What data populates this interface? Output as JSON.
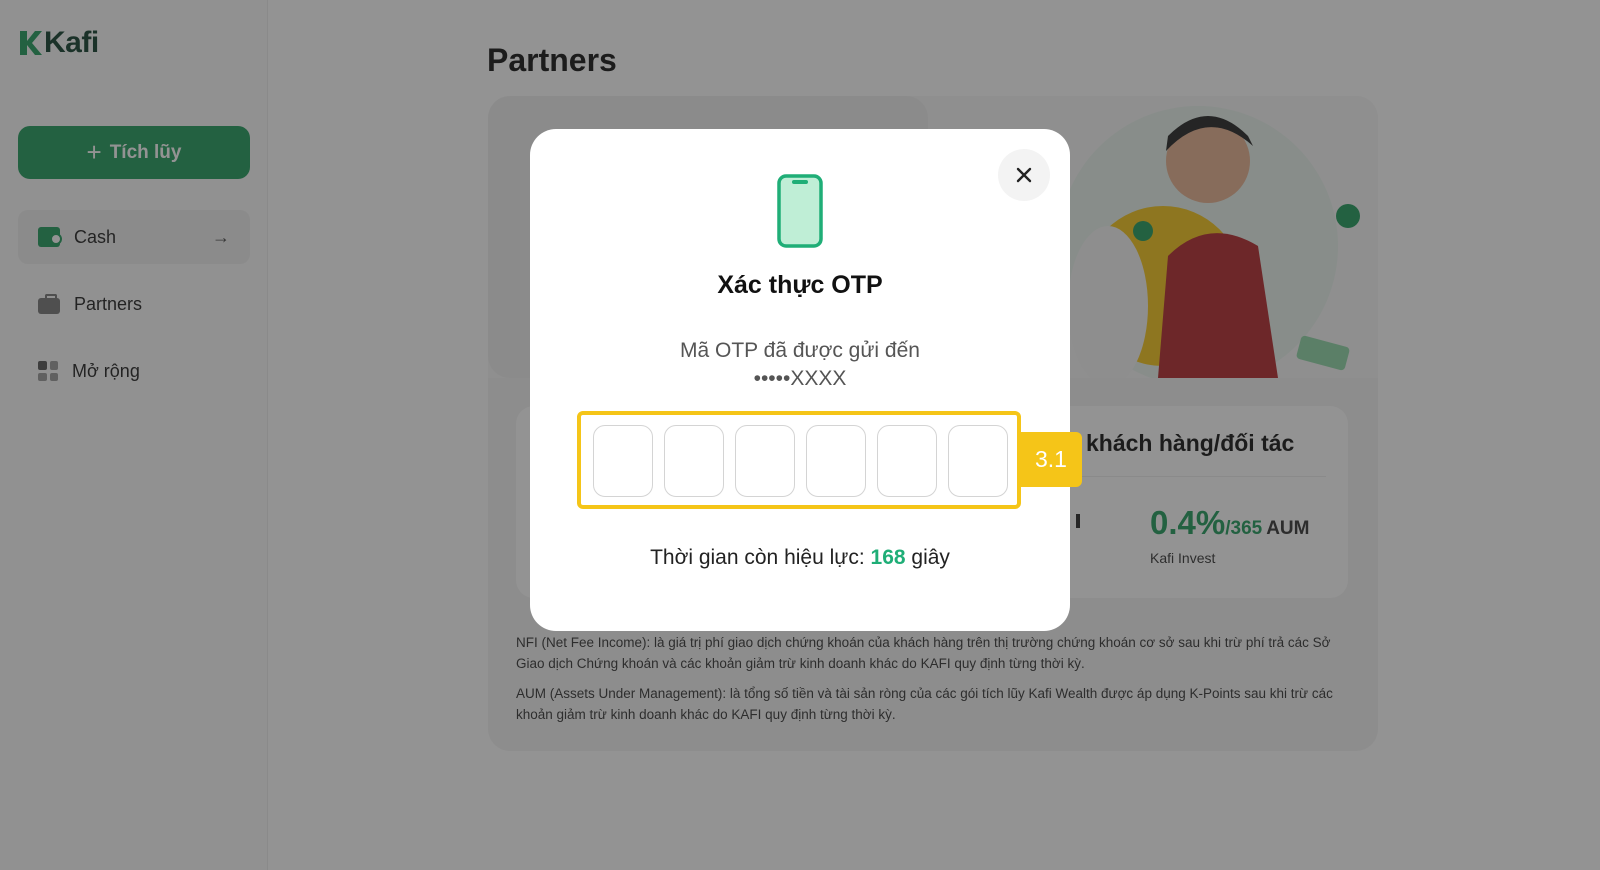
{
  "app": {
    "logo_text": "Kafi"
  },
  "sidebar": {
    "primary_button": {
      "icon": "plus-icon",
      "label": "Tích lũy"
    },
    "items": [
      {
        "label": "Cash",
        "icon": "wallet-icon",
        "active": true
      },
      {
        "label": "Partners",
        "icon": "briefcase-icon",
        "active": false
      },
      {
        "label": "Mở rộng",
        "icon": "grid-icon",
        "active": false
      }
    ]
  },
  "main": {
    "page_title": "Partners",
    "stats": {
      "title_fragment": "khách hàng/đối tác",
      "value_big": "0.4%",
      "value_small": "/365",
      "value_unit": "AUM",
      "caption": "Kafi Invest"
    },
    "footnotes": [
      "NFI (Net Fee Income): là giá trị phí giao dịch chứng khoán của khách hàng trên thị trường chứng khoán cơ sở sau khi trừ phí trả các Sở Giao dịch Chứng khoán và các khoản giảm trừ kinh doanh khác do KAFI quy định từng thời kỳ.",
      "AUM (Assets Under Management): là tổng số tiền và tài sản ròng của các gói tích lũy Kafi Wealth được áp dụng K-Points sau khi trừ các khoản giảm trừ kinh doanh khác do KAFI quy định từng thời kỳ."
    ]
  },
  "modal": {
    "title": "Xác thực OTP",
    "description_line1": "Mã OTP đã được gửi đến",
    "description_line2": "•••••XXXX",
    "otp_length": 6,
    "timer_prefix": "Thời gian còn hiệu lực:",
    "timer_seconds": "168",
    "timer_suffix": "giây",
    "step_badge": "3.1"
  },
  "colors": {
    "brand_green": "#1f9a5a",
    "accent_teal": "#1fae77",
    "highlight_yellow": "#f5c518"
  }
}
